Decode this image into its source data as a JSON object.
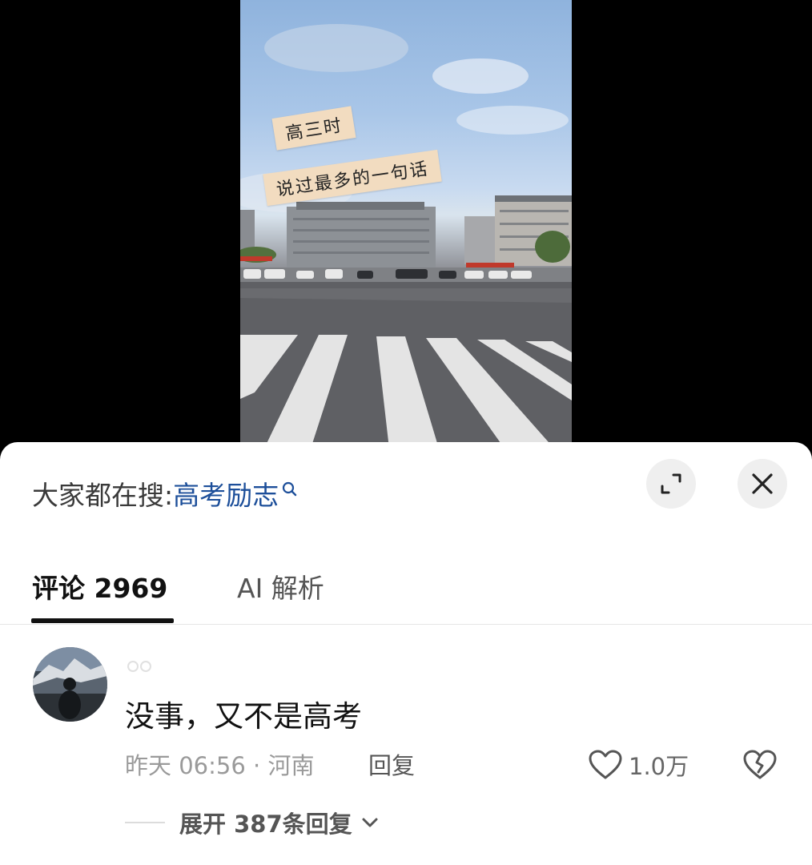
{
  "video": {
    "sticker_line1": "高三时",
    "sticker_line2": "说过最多的一句话"
  },
  "sheet": {
    "search_label": "大家都在搜:",
    "search_keyword": "高考励志",
    "icons": {
      "search": "search-icon",
      "expand": "expand-icon",
      "close": "close-icon"
    }
  },
  "tabs": [
    {
      "label": "评论 2969",
      "active": true
    },
    {
      "label": "AI 解析",
      "active": false
    }
  ],
  "comment": {
    "text": "没事，又不是高考",
    "meta": "昨天 06:56 · 河南",
    "reply_label": "回复",
    "like_count": "1.0万",
    "expand_replies_label": "展开 387条回复"
  },
  "colors": {
    "keyword": "#1d4f9a",
    "tab_indicator": "#111111",
    "sheet_background": "#ffffff"
  }
}
